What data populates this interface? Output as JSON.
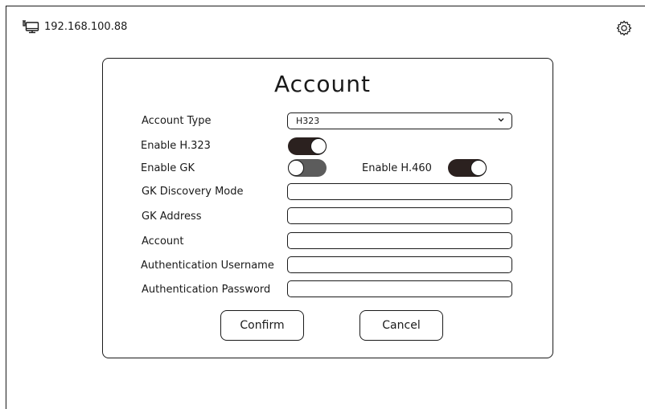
{
  "header": {
    "ip_address": "192.168.100.88"
  },
  "dialog": {
    "title": "Account",
    "account_type": {
      "label": "Account Type",
      "value": "H323"
    },
    "enable_h323": {
      "label": "Enable H.323",
      "state": "on"
    },
    "enable_gk": {
      "label": "Enable GK",
      "state": "off"
    },
    "enable_h460": {
      "label": "Enable H.460",
      "state": "on"
    },
    "gk_discovery_mode": {
      "label": "GK Discovery Mode",
      "value": ""
    },
    "gk_address": {
      "label": "GK Address",
      "value": ""
    },
    "account": {
      "label": "Account",
      "value": ""
    },
    "auth_username": {
      "label": "Authentication Username",
      "value": ""
    },
    "auth_password": {
      "label": "Authentication Password",
      "value": ""
    },
    "confirm_label": "Confirm",
    "cancel_label": "Cancel"
  },
  "icons": {
    "network": "monitor-network-icon",
    "settings": "gear-icon",
    "dropdown": "chevron-down-icon"
  },
  "colors": {
    "toggle_on": "#2b211f",
    "toggle_off": "#5c5c5c",
    "border": "#1a1a1a"
  }
}
